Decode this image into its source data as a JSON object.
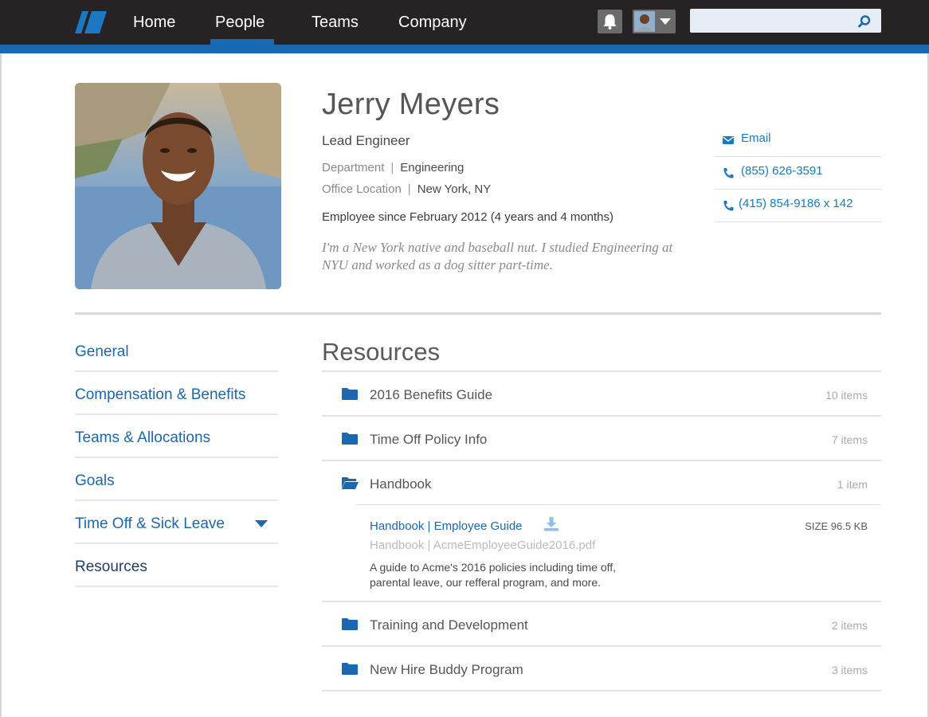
{
  "nav": {
    "items": [
      "Home",
      "People",
      "Teams",
      "Company"
    ],
    "active": "People"
  },
  "search": {
    "value": "",
    "placeholder": ""
  },
  "profile": {
    "name": "Jerry Meyers",
    "title": "Lead Engineer",
    "department_label": "Department",
    "department": "Engineering",
    "location_label": "Office Location",
    "location": "New York, NY",
    "since": "Employee since February 2012 (4 years and 4 months)",
    "bio": "I'm a New York native and baseball nut. I studied Engineering at NYU and worked as a dog sitter part-time."
  },
  "contacts": [
    {
      "icon": "envelope-icon",
      "label": "Email"
    },
    {
      "icon": "phone-icon",
      "label": "(855) 626-3591"
    },
    {
      "icon": "phone-icon",
      "label": "(415) 854-9186 x 142"
    }
  ],
  "sidebar": {
    "items": [
      {
        "label": "General"
      },
      {
        "label": "Compensation & Benefits"
      },
      {
        "label": "Teams & Allocations"
      },
      {
        "label": "Goals"
      },
      {
        "label": "Time Off & Sick Leave"
      },
      {
        "label": "Resources"
      }
    ],
    "current": "Resources"
  },
  "resources": {
    "heading": "Resources",
    "folders": [
      {
        "name": "2016 Benefits Guide",
        "count": "10 items"
      },
      {
        "name": "Time Off Policy Info",
        "count": "7 items"
      },
      {
        "name": "Handbook",
        "count": "1 item"
      },
      {
        "name": "Training and Development",
        "count": "2 items"
      },
      {
        "name": "New Hire Buddy Program",
        "count": "3 items"
      }
    ],
    "open_file": {
      "title": "Handbook | Employee Guide",
      "size": "SIZE 96.5 KB",
      "path": "Handbook | AcmeEmployeeGuide2016.pdf",
      "description": "A guide to Acme's 2016 policies including time off, parental leave, our refferal program, and more."
    }
  },
  "colors": {
    "nav_bg": "#272324",
    "accent": "#1a67b2",
    "link": "#1a79c2"
  }
}
